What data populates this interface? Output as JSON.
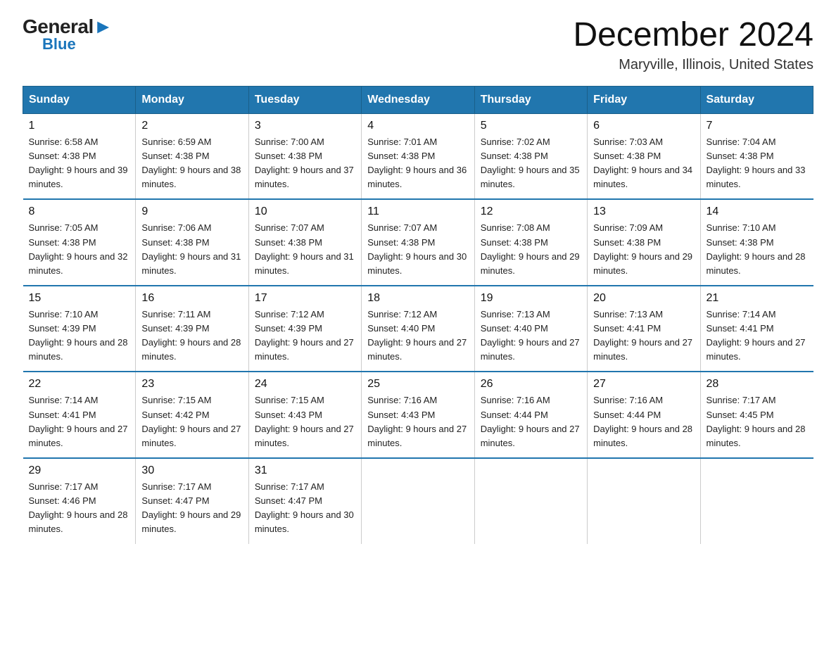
{
  "logo": {
    "general": "General",
    "blue": "Blue",
    "arrow": "▶"
  },
  "header": {
    "month_title": "December 2024",
    "location": "Maryville, Illinois, United States"
  },
  "days_of_week": [
    "Sunday",
    "Monday",
    "Tuesday",
    "Wednesday",
    "Thursday",
    "Friday",
    "Saturday"
  ],
  "weeks": [
    [
      {
        "day": "1",
        "sunrise": "6:58 AM",
        "sunset": "4:38 PM",
        "daylight": "9 hours and 39 minutes."
      },
      {
        "day": "2",
        "sunrise": "6:59 AM",
        "sunset": "4:38 PM",
        "daylight": "9 hours and 38 minutes."
      },
      {
        "day": "3",
        "sunrise": "7:00 AM",
        "sunset": "4:38 PM",
        "daylight": "9 hours and 37 minutes."
      },
      {
        "day": "4",
        "sunrise": "7:01 AM",
        "sunset": "4:38 PM",
        "daylight": "9 hours and 36 minutes."
      },
      {
        "day": "5",
        "sunrise": "7:02 AM",
        "sunset": "4:38 PM",
        "daylight": "9 hours and 35 minutes."
      },
      {
        "day": "6",
        "sunrise": "7:03 AM",
        "sunset": "4:38 PM",
        "daylight": "9 hours and 34 minutes."
      },
      {
        "day": "7",
        "sunrise": "7:04 AM",
        "sunset": "4:38 PM",
        "daylight": "9 hours and 33 minutes."
      }
    ],
    [
      {
        "day": "8",
        "sunrise": "7:05 AM",
        "sunset": "4:38 PM",
        "daylight": "9 hours and 32 minutes."
      },
      {
        "day": "9",
        "sunrise": "7:06 AM",
        "sunset": "4:38 PM",
        "daylight": "9 hours and 31 minutes."
      },
      {
        "day": "10",
        "sunrise": "7:07 AM",
        "sunset": "4:38 PM",
        "daylight": "9 hours and 31 minutes."
      },
      {
        "day": "11",
        "sunrise": "7:07 AM",
        "sunset": "4:38 PM",
        "daylight": "9 hours and 30 minutes."
      },
      {
        "day": "12",
        "sunrise": "7:08 AM",
        "sunset": "4:38 PM",
        "daylight": "9 hours and 29 minutes."
      },
      {
        "day": "13",
        "sunrise": "7:09 AM",
        "sunset": "4:38 PM",
        "daylight": "9 hours and 29 minutes."
      },
      {
        "day": "14",
        "sunrise": "7:10 AM",
        "sunset": "4:38 PM",
        "daylight": "9 hours and 28 minutes."
      }
    ],
    [
      {
        "day": "15",
        "sunrise": "7:10 AM",
        "sunset": "4:39 PM",
        "daylight": "9 hours and 28 minutes."
      },
      {
        "day": "16",
        "sunrise": "7:11 AM",
        "sunset": "4:39 PM",
        "daylight": "9 hours and 28 minutes."
      },
      {
        "day": "17",
        "sunrise": "7:12 AM",
        "sunset": "4:39 PM",
        "daylight": "9 hours and 27 minutes."
      },
      {
        "day": "18",
        "sunrise": "7:12 AM",
        "sunset": "4:40 PM",
        "daylight": "9 hours and 27 minutes."
      },
      {
        "day": "19",
        "sunrise": "7:13 AM",
        "sunset": "4:40 PM",
        "daylight": "9 hours and 27 minutes."
      },
      {
        "day": "20",
        "sunrise": "7:13 AM",
        "sunset": "4:41 PM",
        "daylight": "9 hours and 27 minutes."
      },
      {
        "day": "21",
        "sunrise": "7:14 AM",
        "sunset": "4:41 PM",
        "daylight": "9 hours and 27 minutes."
      }
    ],
    [
      {
        "day": "22",
        "sunrise": "7:14 AM",
        "sunset": "4:41 PM",
        "daylight": "9 hours and 27 minutes."
      },
      {
        "day": "23",
        "sunrise": "7:15 AM",
        "sunset": "4:42 PM",
        "daylight": "9 hours and 27 minutes."
      },
      {
        "day": "24",
        "sunrise": "7:15 AM",
        "sunset": "4:43 PM",
        "daylight": "9 hours and 27 minutes."
      },
      {
        "day": "25",
        "sunrise": "7:16 AM",
        "sunset": "4:43 PM",
        "daylight": "9 hours and 27 minutes."
      },
      {
        "day": "26",
        "sunrise": "7:16 AM",
        "sunset": "4:44 PM",
        "daylight": "9 hours and 27 minutes."
      },
      {
        "day": "27",
        "sunrise": "7:16 AM",
        "sunset": "4:44 PM",
        "daylight": "9 hours and 28 minutes."
      },
      {
        "day": "28",
        "sunrise": "7:17 AM",
        "sunset": "4:45 PM",
        "daylight": "9 hours and 28 minutes."
      }
    ],
    [
      {
        "day": "29",
        "sunrise": "7:17 AM",
        "sunset": "4:46 PM",
        "daylight": "9 hours and 28 minutes."
      },
      {
        "day": "30",
        "sunrise": "7:17 AM",
        "sunset": "4:47 PM",
        "daylight": "9 hours and 29 minutes."
      },
      {
        "day": "31",
        "sunrise": "7:17 AM",
        "sunset": "4:47 PM",
        "daylight": "9 hours and 30 minutes."
      },
      null,
      null,
      null,
      null
    ]
  ],
  "colors": {
    "header_bg": "#2176ae",
    "header_text": "#ffffff",
    "border": "#2176ae"
  }
}
